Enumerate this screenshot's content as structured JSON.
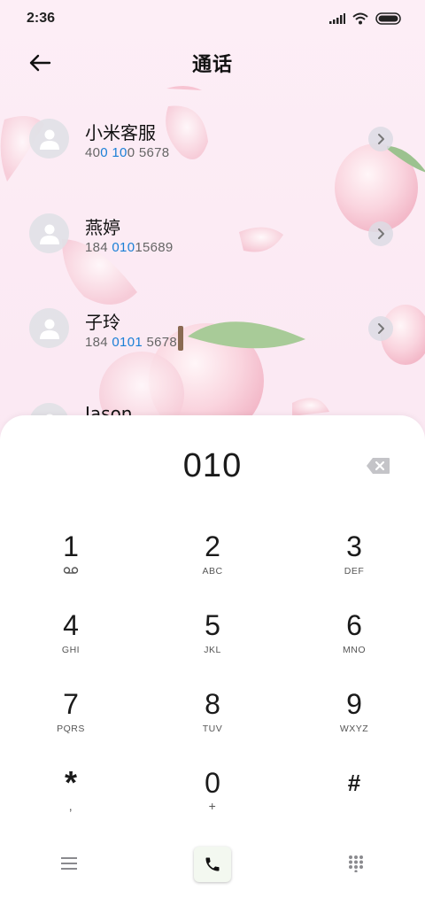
{
  "status_bar": {
    "time": "2:36"
  },
  "header": {
    "title": "通话"
  },
  "contacts": [
    {
      "name": "小米客服",
      "number_parts": [
        "40",
        "0 10",
        "0 5678"
      ]
    },
    {
      "name": "燕婷",
      "number_parts": [
        "184 ",
        "010",
        "15689"
      ]
    },
    {
      "name": "子玲",
      "number_parts": [
        "184 ",
        "0101",
        " 5678"
      ]
    },
    {
      "name": "Jason",
      "number_parts": [
        "",
        "",
        ""
      ]
    }
  ],
  "dialer": {
    "input_value": "010",
    "keys": [
      {
        "digit": "1",
        "letters": ""
      },
      {
        "digit": "2",
        "letters": "ABC"
      },
      {
        "digit": "3",
        "letters": "DEF"
      },
      {
        "digit": "4",
        "letters": "GHI"
      },
      {
        "digit": "5",
        "letters": "JKL"
      },
      {
        "digit": "6",
        "letters": "MNO"
      },
      {
        "digit": "7",
        "letters": "PQRS"
      },
      {
        "digit": "8",
        "letters": "TUV"
      },
      {
        "digit": "9",
        "letters": "WXYZ"
      },
      {
        "digit": "*",
        "letters": ","
      },
      {
        "digit": "0",
        "letters": "+"
      },
      {
        "digit": "#",
        "letters": ""
      }
    ]
  },
  "icons": {
    "back": "arrow-left-icon",
    "avatar": "person-icon",
    "detail": "chevron-right-icon",
    "delete": "backspace-icon",
    "voicemail": "voicemail-icon",
    "menu": "menu-icon",
    "call": "phone-icon",
    "keypad": "dialpad-icon"
  },
  "colors": {
    "highlight": "#1a7fd6",
    "background": "#fbeaf3",
    "panel": "#ffffff"
  }
}
